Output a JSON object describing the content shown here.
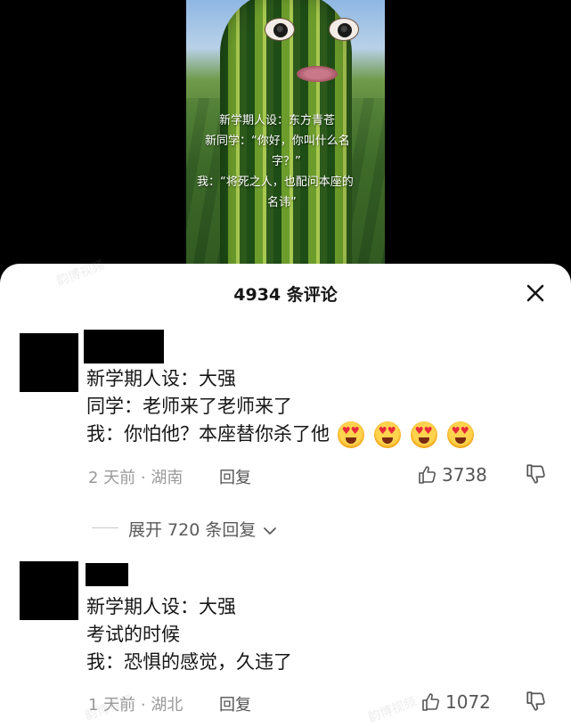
{
  "video": {
    "caption_lines": [
      "新学期人设：东方青苍",
      "新同学：“你好，你叫什么名",
      "字？”",
      "我：“将死之人，也配问本座的",
      "名讳”"
    ]
  },
  "sheet": {
    "title": "4934 条评论"
  },
  "comments": [
    {
      "lines": [
        "新学期人设：大强",
        "同学：老师来了老师来了",
        "我：你怕他？本座替你杀了他"
      ],
      "emoji_count": 4,
      "emoji_icon": "heart-eyes-emoji",
      "time_location": "2 天前 · 湖南",
      "reply_label": "回复",
      "likes": "3738",
      "expand_label": "展开 720 条回复"
    },
    {
      "lines": [
        "新学期人设：大强",
        "考试的时候",
        "我：恐惧的感觉，久违了"
      ],
      "time_location": "1 天前 · 湖北",
      "reply_label": "回复",
      "likes": "1072"
    }
  ],
  "watermarks": [
    "韵博视频",
    "韵博视频",
    "韵博视频"
  ],
  "colors": {
    "sheet_bg": "#ffffff",
    "text": "#161616",
    "meta": "#9a9a9a",
    "redaction": "#000000"
  },
  "icons": [
    "close-icon",
    "thumbs-up-icon",
    "thumbs-down-icon",
    "chevron-down-icon",
    "heart-eyes-emoji"
  ]
}
